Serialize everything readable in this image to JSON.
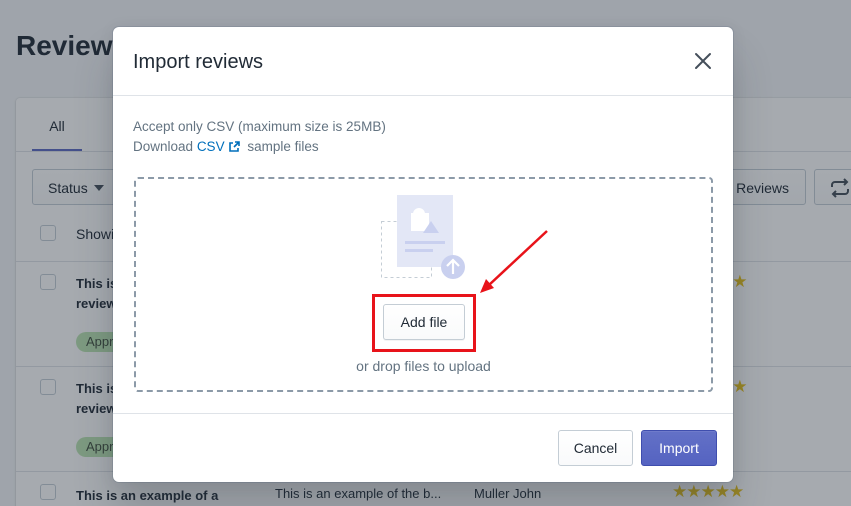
{
  "background": {
    "page_title": "Reviews",
    "tab_all": "All",
    "status_filter": "Status",
    "export_button": "t Reviews",
    "showing_text": "Showi",
    "rows": [
      {
        "title_line1": "This is",
        "title_line2": "review",
        "badge": "Appr"
      },
      {
        "title_line1": "This is",
        "title_line2": "review",
        "badge": "Appr"
      },
      {
        "title": "This is an example of a",
        "body": "This is an example of the b...",
        "author": "Muller John"
      }
    ],
    "star_color": "#e8c21a"
  },
  "modal": {
    "title": "Import reviews",
    "accept_text": "Accept only CSV (maximum size is 25MB)",
    "download_prefix": "Download",
    "csv_link": "CSV",
    "download_suffix": "sample files",
    "add_file_label": "Add file",
    "drop_text": "or drop files to upload",
    "cancel_label": "Cancel",
    "import_label": "Import"
  },
  "icons": {
    "close": "close-icon",
    "external_link": "external-link-icon",
    "upload_illustration": "file-upload-illustration",
    "sync": "sync-icon"
  },
  "colors": {
    "primary": "#5c6ac4",
    "link": "#006fbb",
    "annotation": "#e8131a"
  }
}
